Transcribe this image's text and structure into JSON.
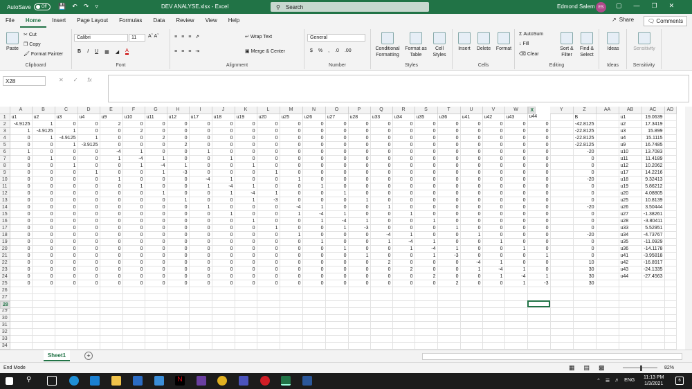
{
  "titlebar": {
    "autosave_label": "AutoSave",
    "autosave_state": "Off",
    "doc_title": "DEV ANALYSE.xlsx  -  Excel",
    "search_placeholder": "Search",
    "user_name": "Edmond Salem",
    "user_initials": "ES"
  },
  "tabs": [
    "File",
    "Home",
    "Insert",
    "Page Layout",
    "Formulas",
    "Data",
    "Review",
    "View",
    "Help"
  ],
  "active_tab": "Home",
  "share_label": "Share",
  "comments_label": "Comments",
  "ribbon": {
    "clipboard": {
      "label": "Clipboard",
      "paste": "Paste",
      "cut": "Cut",
      "copy": "Copy",
      "format_painter": "Format Painter"
    },
    "font": {
      "label": "Font",
      "name": "Calibri",
      "size": "11"
    },
    "alignment": {
      "label": "Alignment",
      "wrap": "Wrap Text",
      "merge": "Merge & Center"
    },
    "number": {
      "label": "Number",
      "format": "General"
    },
    "styles": {
      "label": "Styles",
      "cond": "Conditional Formatting",
      "table": "Format as Table",
      "cell": "Cell Styles"
    },
    "cells": {
      "label": "Cells",
      "insert": "Insert",
      "delete": "Delete",
      "format": "Format"
    },
    "editing": {
      "label": "Editing",
      "autosum": "AutoSum",
      "fill": "Fill",
      "clear": "Clear",
      "sort": "Sort & Filter",
      "find": "Find & Select"
    },
    "ideas": {
      "label": "Ideas",
      "btn": "Ideas"
    },
    "sensitivity": {
      "label": "Sensitivity",
      "btn": "Sensitivity"
    }
  },
  "namebox": "X28",
  "columns": [
    "A",
    "B",
    "C",
    "D",
    "E",
    "F",
    "G",
    "H",
    "I",
    "J",
    "K",
    "L",
    "M",
    "N",
    "O",
    "P",
    "Q",
    "R",
    "S",
    "T",
    "U",
    "V",
    "W",
    "X",
    "Y",
    "Z",
    "AA",
    "AB",
    "AC",
    "AD"
  ],
  "rows": [
    [
      "u1",
      "u2",
      "u3",
      "u4",
      "u9",
      "u10",
      "u11",
      "u12",
      "u17",
      "u18",
      "u19",
      "u20",
      "u25",
      "u26",
      "u27",
      "u28",
      "u33",
      "u34",
      "u35",
      "u36",
      "u41",
      "u42",
      "u43",
      "u44",
      "",
      "B",
      "",
      "u1",
      "19.0639",
      ""
    ],
    [
      "-4.9125",
      "1",
      "0",
      "0",
      "2",
      "0",
      "0",
      "0",
      "0",
      "0",
      "0",
      "0",
      "0",
      "0",
      "0",
      "0",
      "0",
      "0",
      "0",
      "0",
      "0",
      "0",
      "0",
      "0",
      "",
      "-42.8125",
      "",
      "u2",
      "17.3419",
      ""
    ],
    [
      "1",
      "-4.9125",
      "1",
      "0",
      "0",
      "2",
      "0",
      "0",
      "0",
      "0",
      "0",
      "0",
      "0",
      "0",
      "0",
      "0",
      "0",
      "0",
      "0",
      "0",
      "0",
      "0",
      "0",
      "0",
      "",
      "-22.8125",
      "",
      "u3",
      "15.899",
      ""
    ],
    [
      "0",
      "1",
      "-4.9125",
      "1",
      "0",
      "0",
      "2",
      "0",
      "0",
      "0",
      "0",
      "0",
      "0",
      "0",
      "0",
      "0",
      "0",
      "0",
      "0",
      "0",
      "0",
      "0",
      "0",
      "0",
      "",
      "-22.8125",
      "",
      "u4",
      "15.1115",
      ""
    ],
    [
      "0",
      "0",
      "1",
      "-3.9125",
      "0",
      "0",
      "0",
      "2",
      "0",
      "0",
      "0",
      "0",
      "0",
      "0",
      "0",
      "0",
      "0",
      "0",
      "0",
      "0",
      "0",
      "0",
      "0",
      "0",
      "",
      "-22.8125",
      "",
      "u9",
      "16.7485",
      ""
    ],
    [
      "1",
      "0",
      "0",
      "0",
      "-4",
      "1",
      "0",
      "0",
      "1",
      "0",
      "0",
      "0",
      "0",
      "0",
      "0",
      "0",
      "0",
      "0",
      "0",
      "0",
      "0",
      "0",
      "0",
      "0",
      "",
      "-20",
      "",
      "u10",
      "13.7083",
      ""
    ],
    [
      "0",
      "1",
      "0",
      "0",
      "1",
      "-4",
      "1",
      "0",
      "0",
      "1",
      "0",
      "0",
      "0",
      "0",
      "0",
      "0",
      "0",
      "0",
      "0",
      "0",
      "0",
      "0",
      "0",
      "0",
      "",
      "0",
      "",
      "u11",
      "11.4189",
      ""
    ],
    [
      "0",
      "0",
      "1",
      "0",
      "0",
      "1",
      "-4",
      "1",
      "0",
      "0",
      "1",
      "0",
      "0",
      "0",
      "0",
      "0",
      "0",
      "0",
      "0",
      "0",
      "0",
      "0",
      "0",
      "0",
      "",
      "0",
      "",
      "u12",
      "10.2062",
      ""
    ],
    [
      "0",
      "0",
      "0",
      "1",
      "0",
      "0",
      "1",
      "-3",
      "0",
      "0",
      "0",
      "1",
      "0",
      "0",
      "0",
      "0",
      "0",
      "0",
      "0",
      "0",
      "0",
      "0",
      "0",
      "0",
      "",
      "0",
      "",
      "u17",
      "14.2216",
      ""
    ],
    [
      "0",
      "0",
      "0",
      "0",
      "1",
      "0",
      "0",
      "0",
      "-4",
      "1",
      "0",
      "0",
      "1",
      "0",
      "0",
      "0",
      "0",
      "0",
      "0",
      "0",
      "0",
      "0",
      "0",
      "0",
      "",
      "-20",
      "",
      "u18",
      "9.32413",
      ""
    ],
    [
      "0",
      "0",
      "0",
      "0",
      "0",
      "1",
      "0",
      "0",
      "1",
      "-4",
      "1",
      "0",
      "0",
      "1",
      "0",
      "0",
      "0",
      "0",
      "0",
      "0",
      "0",
      "0",
      "0",
      "0",
      "",
      "0",
      "",
      "u19",
      "5.86212",
      ""
    ],
    [
      "0",
      "0",
      "0",
      "0",
      "0",
      "0",
      "1",
      "0",
      "0",
      "1",
      "-4",
      "1",
      "0",
      "0",
      "1",
      "0",
      "0",
      "0",
      "0",
      "0",
      "0",
      "0",
      "0",
      "0",
      "",
      "0",
      "",
      "u20",
      "4.08805",
      ""
    ],
    [
      "0",
      "0",
      "0",
      "0",
      "0",
      "0",
      "0",
      "1",
      "0",
      "0",
      "1",
      "-3",
      "0",
      "0",
      "0",
      "1",
      "0",
      "0",
      "0",
      "0",
      "0",
      "0",
      "0",
      "0",
      "",
      "0",
      "",
      "u25",
      "10.8139",
      ""
    ],
    [
      "0",
      "0",
      "0",
      "0",
      "0",
      "0",
      "0",
      "0",
      "1",
      "0",
      "0",
      "0",
      "-4",
      "1",
      "0",
      "0",
      "1",
      "0",
      "0",
      "0",
      "0",
      "0",
      "0",
      "0",
      "",
      "-20",
      "",
      "u26",
      "3.50444",
      ""
    ],
    [
      "0",
      "0",
      "0",
      "0",
      "0",
      "0",
      "0",
      "0",
      "0",
      "1",
      "0",
      "0",
      "1",
      "-4",
      "1",
      "0",
      "0",
      "1",
      "0",
      "0",
      "0",
      "0",
      "0",
      "0",
      "",
      "0",
      "",
      "u27",
      "-1.38261",
      ""
    ],
    [
      "0",
      "0",
      "0",
      "0",
      "0",
      "0",
      "0",
      "0",
      "0",
      "0",
      "1",
      "0",
      "0",
      "1",
      "-4",
      "1",
      "0",
      "0",
      "1",
      "0",
      "0",
      "0",
      "0",
      "0",
      "",
      "0",
      "",
      "u28",
      "-3.80411",
      ""
    ],
    [
      "0",
      "0",
      "0",
      "0",
      "0",
      "0",
      "0",
      "0",
      "0",
      "0",
      "0",
      "1",
      "0",
      "0",
      "1",
      "-3",
      "0",
      "0",
      "0",
      "1",
      "0",
      "0",
      "0",
      "0",
      "",
      "0",
      "",
      "u33",
      "5.52951",
      ""
    ],
    [
      "0",
      "0",
      "0",
      "0",
      "0",
      "0",
      "0",
      "0",
      "0",
      "0",
      "0",
      "0",
      "1",
      "0",
      "0",
      "0",
      "-4",
      "1",
      "0",
      "0",
      "1",
      "0",
      "0",
      "0",
      "",
      "-20",
      "",
      "u34",
      "-4.73767",
      ""
    ],
    [
      "0",
      "0",
      "0",
      "0",
      "0",
      "0",
      "0",
      "0",
      "0",
      "0",
      "0",
      "0",
      "0",
      "1",
      "0",
      "0",
      "1",
      "-4",
      "1",
      "0",
      "0",
      "1",
      "0",
      "0",
      "",
      "0",
      "",
      "u35",
      "-11.0929",
      ""
    ],
    [
      "0",
      "0",
      "0",
      "0",
      "0",
      "0",
      "0",
      "0",
      "0",
      "0",
      "0",
      "0",
      "0",
      "0",
      "1",
      "0",
      "0",
      "1",
      "-4",
      "1",
      "0",
      "0",
      "1",
      "0",
      "",
      "0",
      "",
      "u36",
      "-14.1178",
      ""
    ],
    [
      "0",
      "0",
      "0",
      "0",
      "0",
      "0",
      "0",
      "0",
      "0",
      "0",
      "0",
      "0",
      "0",
      "0",
      "0",
      "1",
      "0",
      "0",
      "1",
      "-3",
      "0",
      "0",
      "0",
      "1",
      "",
      "0",
      "",
      "u41",
      "-3.95818",
      ""
    ],
    [
      "0",
      "0",
      "0",
      "0",
      "0",
      "0",
      "0",
      "0",
      "0",
      "0",
      "0",
      "0",
      "0",
      "0",
      "0",
      "0",
      "2",
      "0",
      "0",
      "0",
      "-4",
      "1",
      "0",
      "0",
      "",
      "10",
      "",
      "u42",
      "-16.8917",
      ""
    ],
    [
      "0",
      "0",
      "0",
      "0",
      "0",
      "0",
      "0",
      "0",
      "0",
      "0",
      "0",
      "0",
      "0",
      "0",
      "0",
      "0",
      "0",
      "2",
      "0",
      "0",
      "1",
      "-4",
      "1",
      "0",
      "",
      "30",
      "",
      "u43",
      "-24.1335",
      ""
    ],
    [
      "0",
      "0",
      "0",
      "0",
      "0",
      "0",
      "0",
      "0",
      "0",
      "0",
      "0",
      "0",
      "0",
      "0",
      "0",
      "0",
      "0",
      "0",
      "2",
      "0",
      "0",
      "1",
      "-4",
      "1",
      "",
      "30",
      "",
      "u44",
      "-27.4563",
      ""
    ],
    [
      "0",
      "0",
      "0",
      "0",
      "0",
      "0",
      "0",
      "0",
      "0",
      "0",
      "0",
      "0",
      "0",
      "0",
      "0",
      "0",
      "0",
      "0",
      "0",
      "2",
      "0",
      "0",
      "1",
      "-3",
      "",
      "30",
      "",
      "",
      "",
      ""
    ]
  ],
  "empty_rows": [
    26,
    27,
    28,
    29,
    30,
    31,
    32,
    33,
    34
  ],
  "sheet_tab": "Sheet1",
  "status": {
    "mode": "End Mode",
    "zoom": "82%"
  },
  "taskbar": {
    "lang": "ENG",
    "time": "11:13 PM",
    "date": "1/3/2021",
    "notif": "6"
  }
}
